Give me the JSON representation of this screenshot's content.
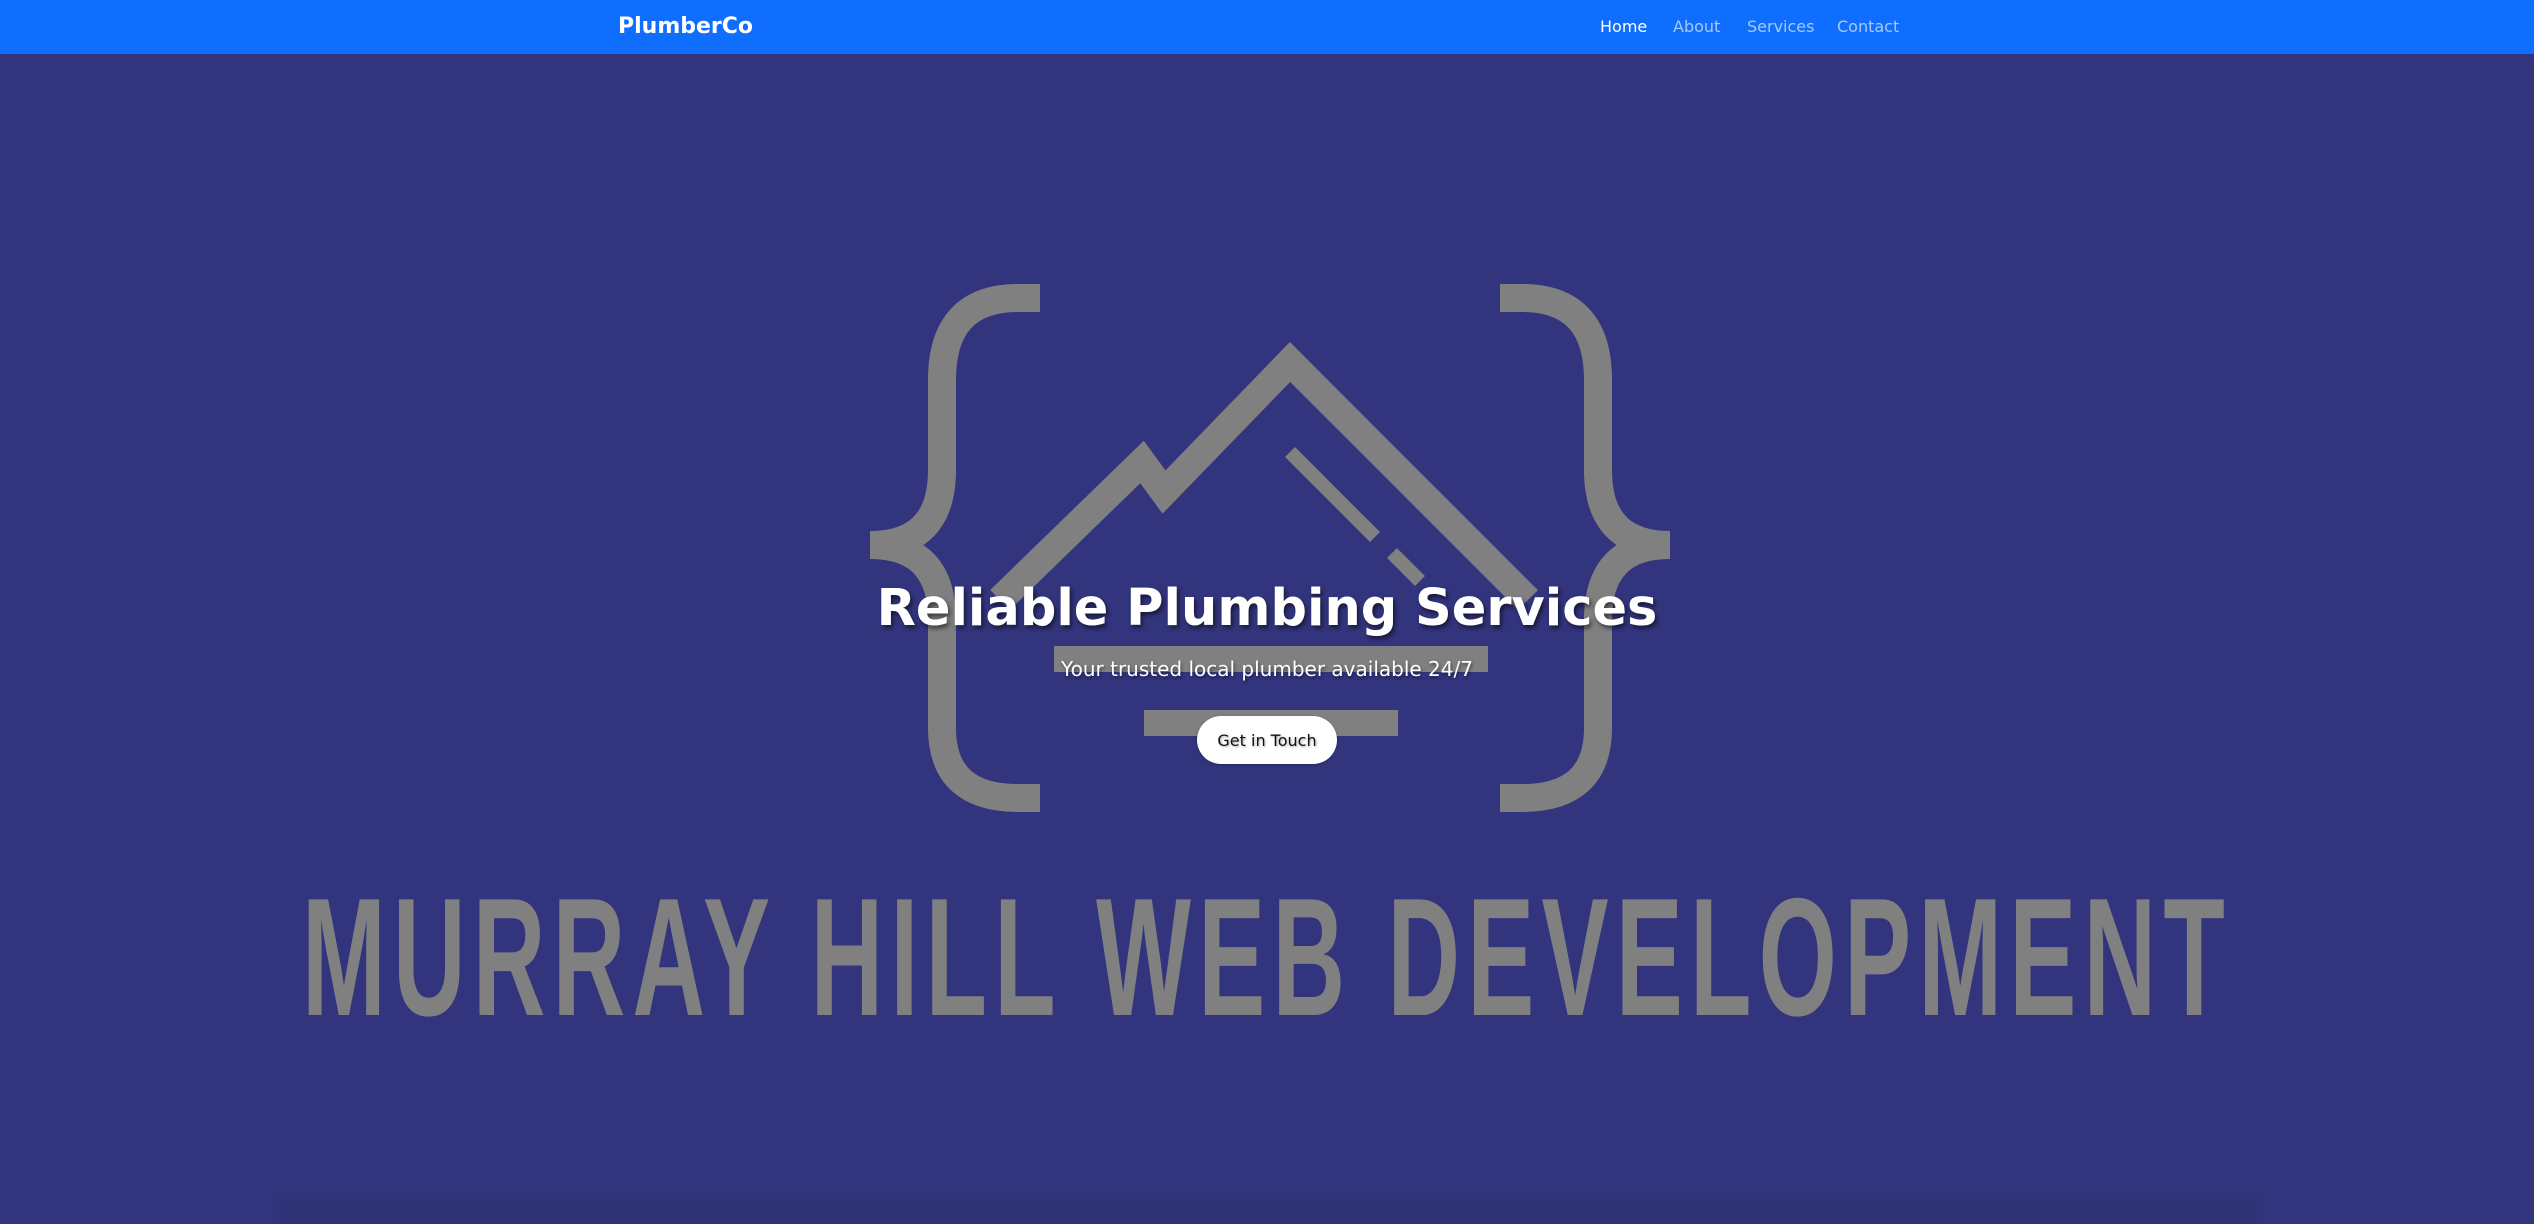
{
  "nav": {
    "brand": "PlumberCo",
    "links": [
      {
        "label": "Home",
        "active": true
      },
      {
        "label": "About",
        "active": false
      },
      {
        "label": "Services",
        "active": false
      },
      {
        "label": "Contact",
        "active": false
      }
    ]
  },
  "hero": {
    "title": "Reliable Plumbing Services",
    "subtitle": "Your trusted local plumber available 24/7",
    "cta_label": "Get in Touch",
    "watermark_text": "MURRAY HILL WEB DEVELOPMENT"
  },
  "colors": {
    "navbar": "#0f6efd",
    "background": "#32357d",
    "watermark": "#808080"
  }
}
